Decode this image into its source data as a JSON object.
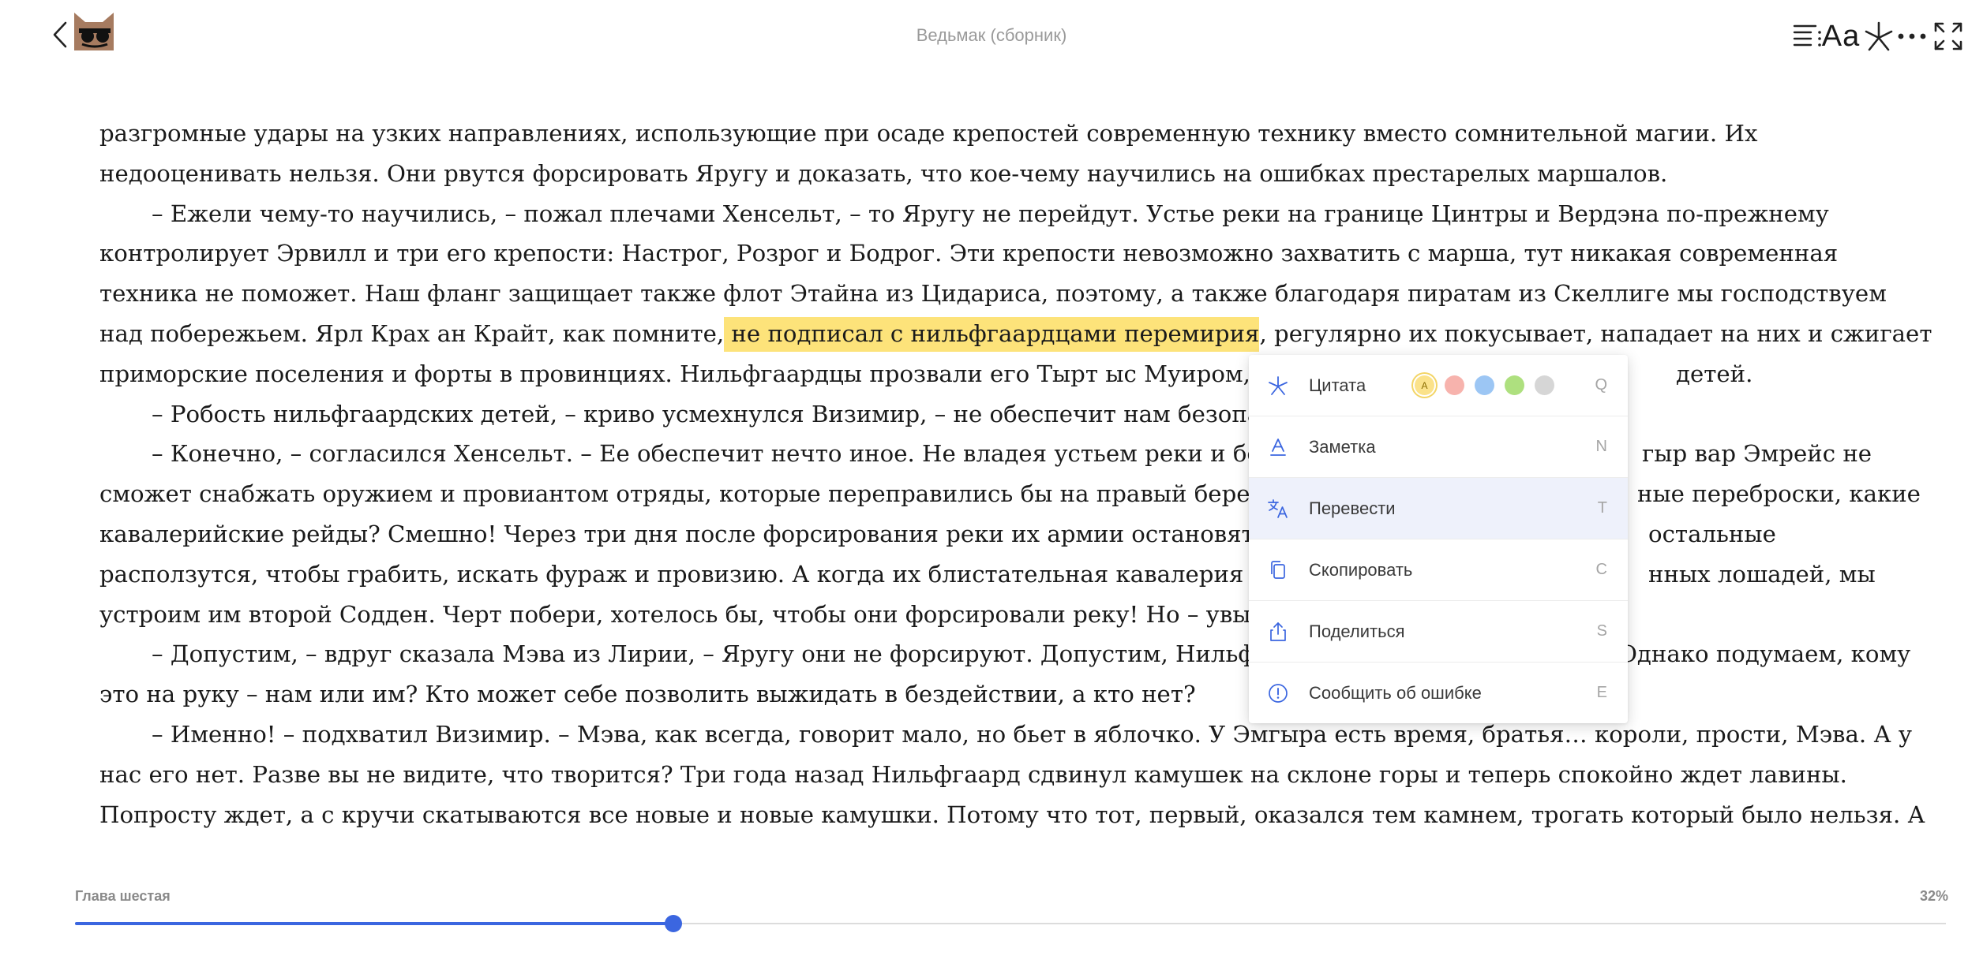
{
  "header": {
    "book_title": "Ведьмак (сборник)",
    "toolbar": {
      "font_label": "Aa"
    }
  },
  "reader": {
    "paragraphs": [
      {
        "text": "разгромные удары на узких направлениях, использующие при осаде крепостей современную технику вместо сомнительной магии. Их"
      },
      {
        "text": "недооценивать нельзя. Они рвутся форсировать Яругу и доказать, что кое-чему научились на ошибках престарелых маршалов."
      },
      {
        "text": "– Ежели чему-то научились, – пожал плечами Хенсельт, – то Яругу не перейдут. Устье реки на границе Цинтры и Вердэна по-прежнему"
      },
      {
        "text": "контролирует Эрвилл и три его крепости: Настрог, Розрог и Бодрог. Эти крепости невозможно захватить с марша, тут никакая современная"
      },
      {
        "text": "техника не поможет. Наш фланг защищает также флот Этайна из Цидариса, поэтому, а также благодаря пиратам из Скеллиге мы господствуем"
      },
      {
        "before": "над побережьем. Ярл Крах ан Крайт, как помните,",
        "highlight": " не подписал с нильфгаардцами перемирия",
        "after": ", регулярно их покусывает, нападает на них и сжигает"
      },
      {
        "text": "приморские поселения и форты в провинциях. Нильфгаардцы прозвали его Тырт ыс Муиром,",
        "tail": "детей."
      },
      {
        "text": "– Робость нильфгаардских детей, – криво усмехнулся Визимир, – не обеспечит нам безопа"
      },
      {
        "text": "– Конечно, – согласился Хенсельт. – Ее обеспечит нечто иное. Не владея устьем реки и бер",
        "tail": "гыр вар Эмрейс не"
      },
      {
        "text": "сможет снабжать оружием и провиантом отряды, которые переправились бы на правый бере",
        "tail": "ные переброски, какие"
      },
      {
        "text": "кавалерийские рейды? Смешно! Через три дня после форсирования реки их армии остановят",
        "tail": "остальные"
      },
      {
        "text": "расползутся, чтобы грабить, искать фураж и провизию. А когда их блистательная кавалерия о",
        "tail": "нных лошадей, мы"
      },
      {
        "text": "устроим им второй Содден. Черт побери, хотелось бы, чтобы они форсировали реку! Но – увы"
      },
      {
        "text": "– Допустим, – вдруг сказала Мэва из Лирии, – Яругу они не форсируют. Допустим, Нильфг",
        "tail": "Однако подумаем, кому"
      },
      {
        "text": "это на руку – нам или им? Кто может себе позволить выжидать в бездействии, а кто нет?"
      },
      {
        "text": "– Именно! – подхватил Визимир. – Мэва, как всегда, говорит мало, но бьет в яблочко. У Эмгыра есть время, братья… короли, прости, Мэва. А у"
      },
      {
        "text": "нас его нет. Разве вы не видите, что творится? Три года назад Нильфгаард сдвинул камушек на склоне горы и теперь спокойно ждет лавины."
      },
      {
        "text": "Попросту ждет, а с кручи скатываются все новые и новые камушки. Потому что тот, первый, оказался тем камнем, трогать который было нельзя. А"
      }
    ]
  },
  "context_menu": {
    "items": [
      {
        "label": "Цитата",
        "key": "Q",
        "icon": "asterisk-icon"
      },
      {
        "label": "Заметка",
        "key": "N",
        "icon": "underline-a-icon"
      },
      {
        "label": "Перевести",
        "key": "T",
        "icon": "translate-icon"
      },
      {
        "label": "Скопировать",
        "key": "C",
        "icon": "copy-icon"
      },
      {
        "label": "Поделиться",
        "key": "S",
        "icon": "share-icon"
      },
      {
        "label": "Сообщить об ошибке",
        "key": "E",
        "icon": "info-icon"
      }
    ],
    "swatch_selected_label": "A",
    "swatch_colors": [
      "#fbe28a",
      "#f7b3ad",
      "#9cc6f4",
      "#aee07f",
      "#d6d6d6"
    ]
  },
  "footer": {
    "chapter": "Глава шестая",
    "percent_label": "32%",
    "progress": 0.32
  },
  "colors": {
    "accent": "#3b66e0",
    "highlight": "#fde37a",
    "menu_active": "#eef1fb"
  }
}
